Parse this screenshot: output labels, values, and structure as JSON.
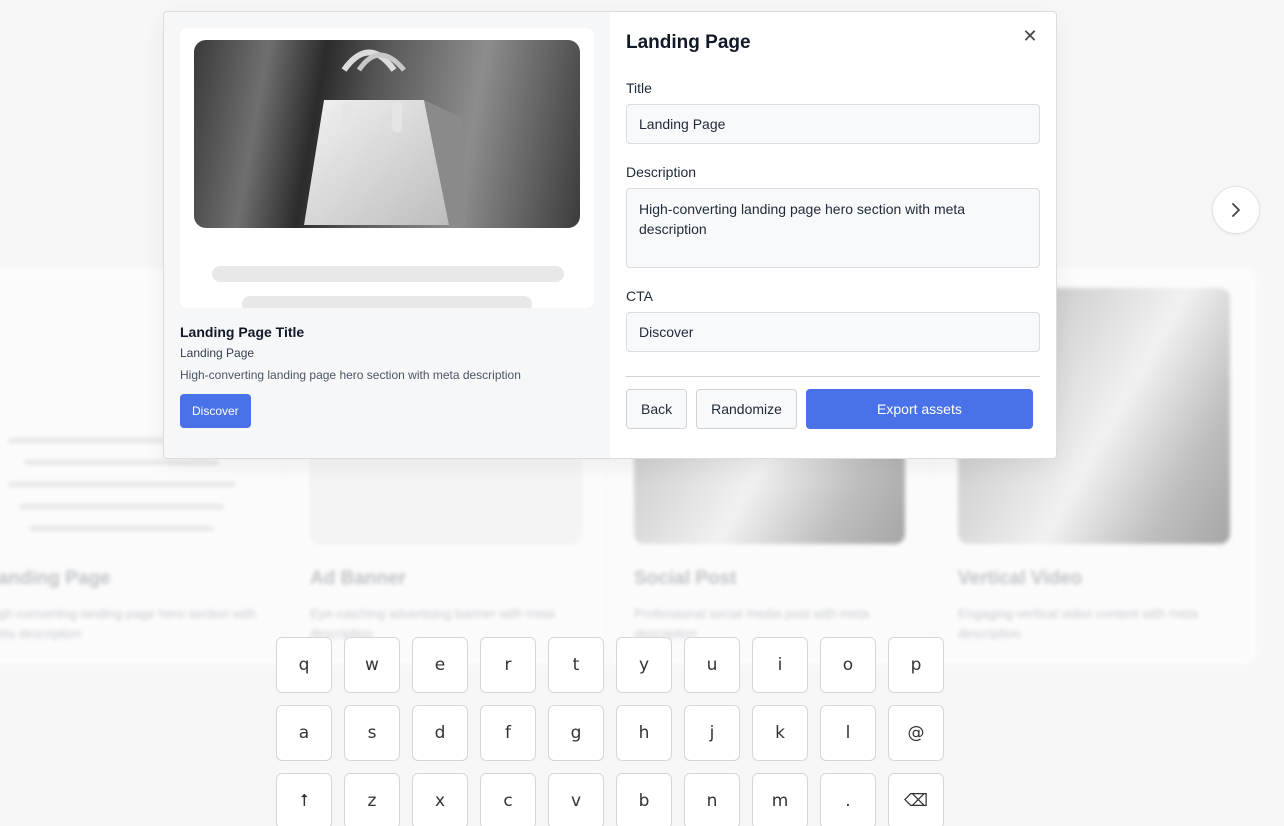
{
  "gallery": {
    "cards": [
      {
        "title": "Landing Page",
        "description": "High-converting landing page hero section with meta description",
        "image": "skeleton-lines"
      },
      {
        "title": "Ad Banner",
        "description": "Eye-catching advertising banner with meta description",
        "image": "plain"
      },
      {
        "title": "Social Post",
        "description": "Professional social media post with meta description",
        "image": "photo"
      },
      {
        "title": "Vertical Video",
        "description": "Engaging vertical video content with meta description",
        "image": "photo"
      }
    ]
  },
  "next_button": {
    "icon": "chevron-right-icon",
    "glyph": "›"
  },
  "modal": {
    "heading": "Landing Page",
    "close_glyph": "✕",
    "preview": {
      "title": "Landing Page Title",
      "subtitle": "Landing Page",
      "description": "High-converting landing page hero section with meta description",
      "cta": "Discover"
    },
    "form": {
      "title_label": "Title",
      "title_value": "Landing Page",
      "description_label": "Description",
      "description_value": "High-converting landing page hero section with meta description",
      "cta_label": "CTA",
      "cta_value": "Discover"
    },
    "actions": {
      "back": "Back",
      "randomize": "Randomize",
      "export": "Export assets"
    }
  },
  "keyboard": {
    "rows": [
      [
        "q",
        "w",
        "e",
        "r",
        "t",
        "y",
        "u",
        "i",
        "o",
        "p"
      ],
      [
        "a",
        "s",
        "d",
        "f",
        "g",
        "h",
        "j",
        "k",
        "l",
        "@"
      ],
      [
        "⭡",
        "z",
        "x",
        "c",
        "v",
        "b",
        "n",
        "m",
        ".",
        "⌫"
      ]
    ]
  },
  "colors": {
    "accent": "#4a72e8",
    "background": "#f7f7f8"
  }
}
